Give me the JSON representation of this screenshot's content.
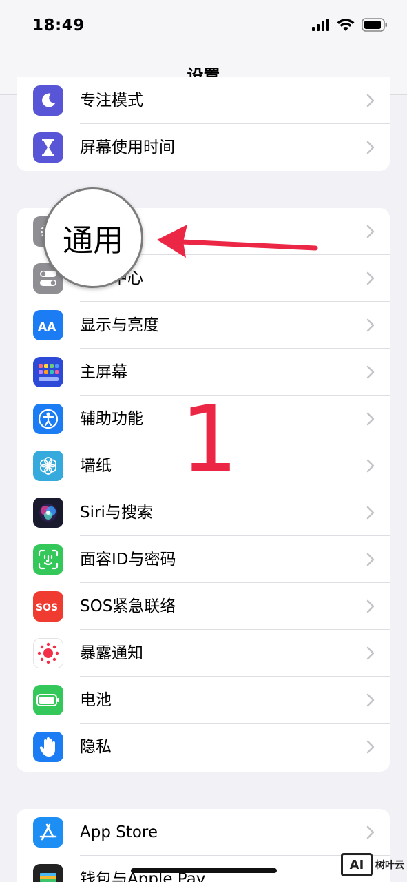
{
  "status_bar": {
    "time": "18:49"
  },
  "nav": {
    "title": "设置"
  },
  "group1": [
    {
      "label": "专注模式",
      "icon": "moon-icon",
      "color": "#5856d6"
    },
    {
      "label": "屏幕使用时间",
      "icon": "hourglass-icon",
      "color": "#5856d6"
    }
  ],
  "group2": [
    {
      "label": "通用",
      "icon": "gear-icon",
      "color": "#8e8e93"
    },
    {
      "label": "控制中心",
      "icon": "toggles-icon",
      "color": "#8e8e93"
    },
    {
      "label": "显示与亮度",
      "icon": "text-size-icon",
      "color": "#1c7cf4"
    },
    {
      "label": "主屏幕",
      "icon": "app-grid-icon",
      "color": "#2d49d8"
    },
    {
      "label": "辅助功能",
      "icon": "accessibility-icon",
      "color": "#1c7cf4"
    },
    {
      "label": "墙纸",
      "icon": "flower-icon",
      "color": "#36aadc"
    },
    {
      "label": "Siri与搜索",
      "icon": "siri-icon",
      "color": "#1a1a2e"
    },
    {
      "label": "面容ID与密码",
      "icon": "face-id-icon",
      "color": "#34c759"
    },
    {
      "label": "SOS紧急联络",
      "icon": "sos-icon",
      "color": "#f03b30"
    },
    {
      "label": "暴露通知",
      "icon": "exposure-icon",
      "color": "#ffffff"
    },
    {
      "label": "电池",
      "icon": "battery-icon",
      "color": "#34c759"
    },
    {
      "label": "隐私",
      "icon": "hand-icon",
      "color": "#1c7cf4"
    }
  ],
  "group3": [
    {
      "label": "App Store",
      "icon": "app-store-icon",
      "color": "#1c8ef4"
    },
    {
      "label": "钱包与Apple Pay",
      "icon": "wallet-icon",
      "color": "#222222"
    }
  ],
  "annotation": {
    "magnifier_text": "通用",
    "step_number": "1",
    "color": "#ec2745"
  },
  "watermark": {
    "logo": "AI",
    "text": "树叶云"
  }
}
